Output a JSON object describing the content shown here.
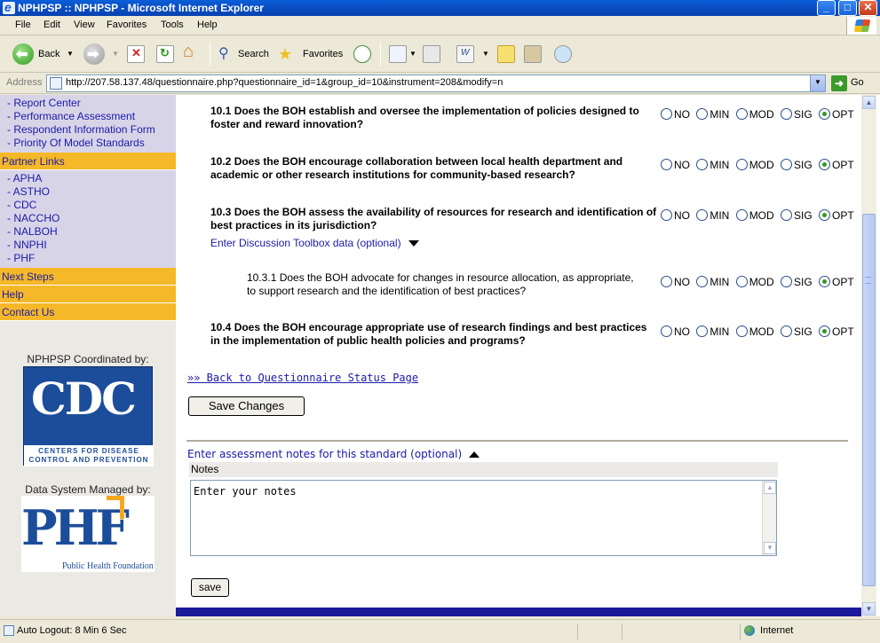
{
  "window": {
    "title": "NPHPSP :: NPHPSP - Microsoft Internet Explorer"
  },
  "menu": [
    "File",
    "Edit",
    "View",
    "Favorites",
    "Tools",
    "Help"
  ],
  "toolbar": {
    "back": "Back",
    "search": "Search",
    "favorites": "Favorites"
  },
  "address": {
    "label": "Address",
    "url": "http://207.58.137.48/questionnaire.php?questionnaire_id=1&group_id=10&instrument=208&modify=n",
    "go": "Go"
  },
  "sidebar": {
    "top_links": [
      "- Report Center",
      "- Performance Assessment",
      "- Respondent Information Form",
      "- Priority Of Model Standards"
    ],
    "partner_heading": "Partner Links",
    "partner_links": [
      "- APHA",
      "- ASTHO",
      "- CDC",
      "- NACCHO",
      "- NALBOH",
      "- NNPHI",
      "- PHF"
    ],
    "next_steps": "Next Steps",
    "help": "Help",
    "contact": "Contact Us",
    "coordinated_by": "NPHPSP Coordinated by:",
    "managed_by": "Data System Managed by:",
    "cdc_logo": {
      "letters": "CDC",
      "sub1": "CENTERS FOR DISEASE",
      "sub2": "CONTROL AND PREVENTION"
    },
    "phf_logo": {
      "letters": "PHF",
      "caption": "Public Health Foundation"
    }
  },
  "radio_labels": [
    "NO",
    "MIN",
    "MOD",
    "SIG",
    "OPT"
  ],
  "questions": [
    {
      "line1": "10.1 Does the BOH establish and oversee the implementation of policies designed to",
      "line2": "foster and reward innovation?",
      "selected": "OPT"
    },
    {
      "line1": "10.2 Does the BOH encourage collaboration between local health department and",
      "line2": "academic or other research institutions for community-based research?",
      "selected": "OPT"
    },
    {
      "line1": "10.3 Does the BOH assess the availability of resources for research and identification of",
      "line2": "best practices in its jurisdiction?",
      "selected": "OPT"
    },
    {
      "line1": "10.3.1 Does the BOH advocate for changes in resource allocation, as appropriate,",
      "line2": "to support research and the identification of best practices?",
      "selected": "OPT"
    },
    {
      "line1": "10.4 Does the BOH encourage appropriate use of research findings and best practices",
      "line2": "in the implementation of public health policies and programs?",
      "selected": "OPT"
    }
  ],
  "discussion_link": "Enter Discussion Toolbox data (optional)",
  "back_link": "»» Back to Questionnaire Status Page",
  "save_changes": "Save Changes",
  "notes": {
    "toggle": "Enter assessment notes for this standard (optional)",
    "header": "Notes",
    "value": "Enter your notes",
    "save": "save"
  },
  "status": {
    "text": "Auto Logout: 8 Min 6 Sec",
    "zone": "Internet"
  },
  "colors": {
    "sidebar_heading": "#f5b828",
    "sidebar_bg": "#d8d4e8",
    "link": "#1a1aa8",
    "bottom_bar": "#1a1a9a"
  }
}
